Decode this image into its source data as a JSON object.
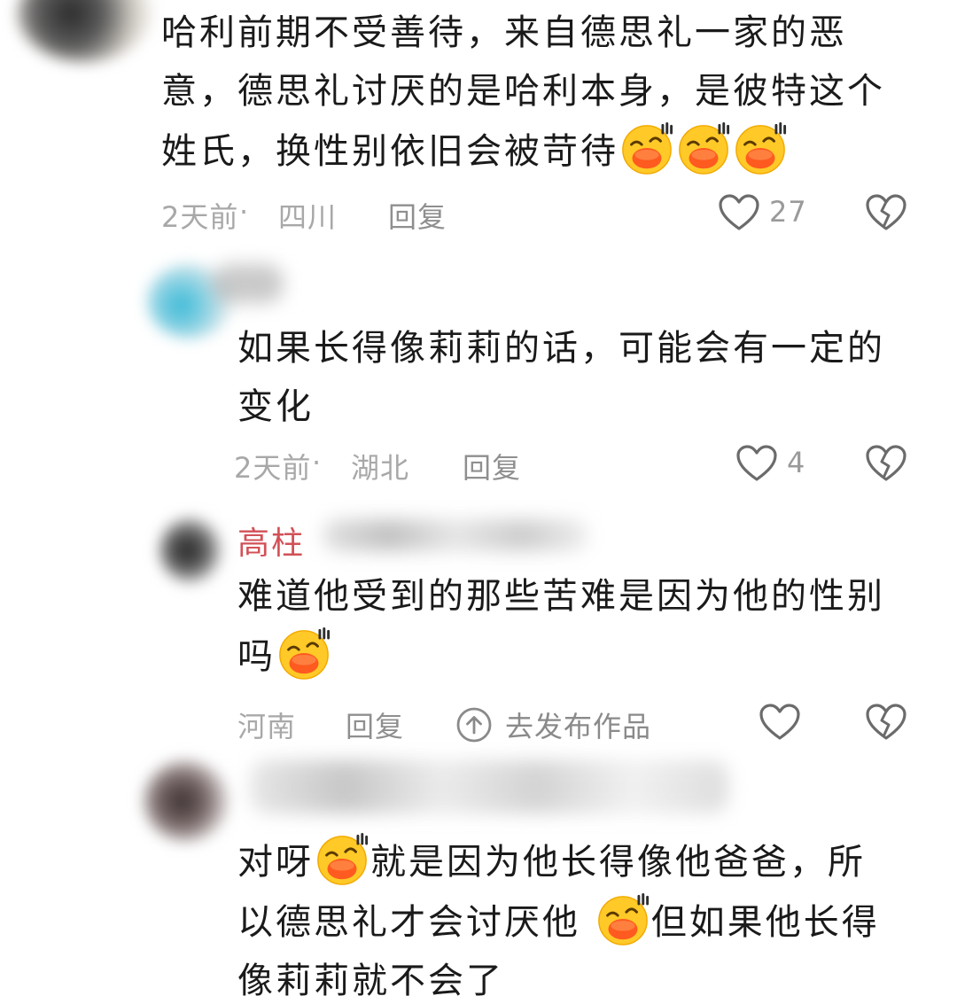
{
  "comments": [
    {
      "lines": [
        "哈利前期不受善待，来自德思礼一家的恶",
        "意，德思礼讨厌的是哈利本身，是彼特这个",
        "姓氏，换性别依旧会被苛待"
      ],
      "time": "2天前",
      "location": "四川",
      "reply_label": "回复",
      "likes": "27"
    },
    {
      "lines": [
        "如果长得像莉莉的话，可能会有一定的",
        "变化"
      ],
      "time": "2天前",
      "location": "湖北",
      "reply_label": "回复",
      "likes": "4"
    },
    {
      "username": "高柱",
      "lines": [
        "难道他受到的那些苦难是因为他的性别",
        "吗"
      ],
      "location": "河南",
      "reply_label": "回复",
      "publish_label": "去发布作品"
    },
    {
      "segments": [
        "对呀",
        "就是因为他长得像他爸爸，所",
        "以德思礼才会讨厌他 ",
        "但如果他长得",
        "像莉莉就不会了"
      ]
    }
  ],
  "separator": " · ",
  "icons": {
    "emoji": "grinning-sweat-emoji",
    "like": "heart-outline-icon",
    "dislike": "broken-heart-icon",
    "publish": "up-arrow-circle-icon"
  },
  "colors": {
    "username": "#d25157",
    "meta": "#a8a8a8",
    "emoji_face": "#ffc928",
    "emoji_mouth": "#ff5a1f"
  }
}
